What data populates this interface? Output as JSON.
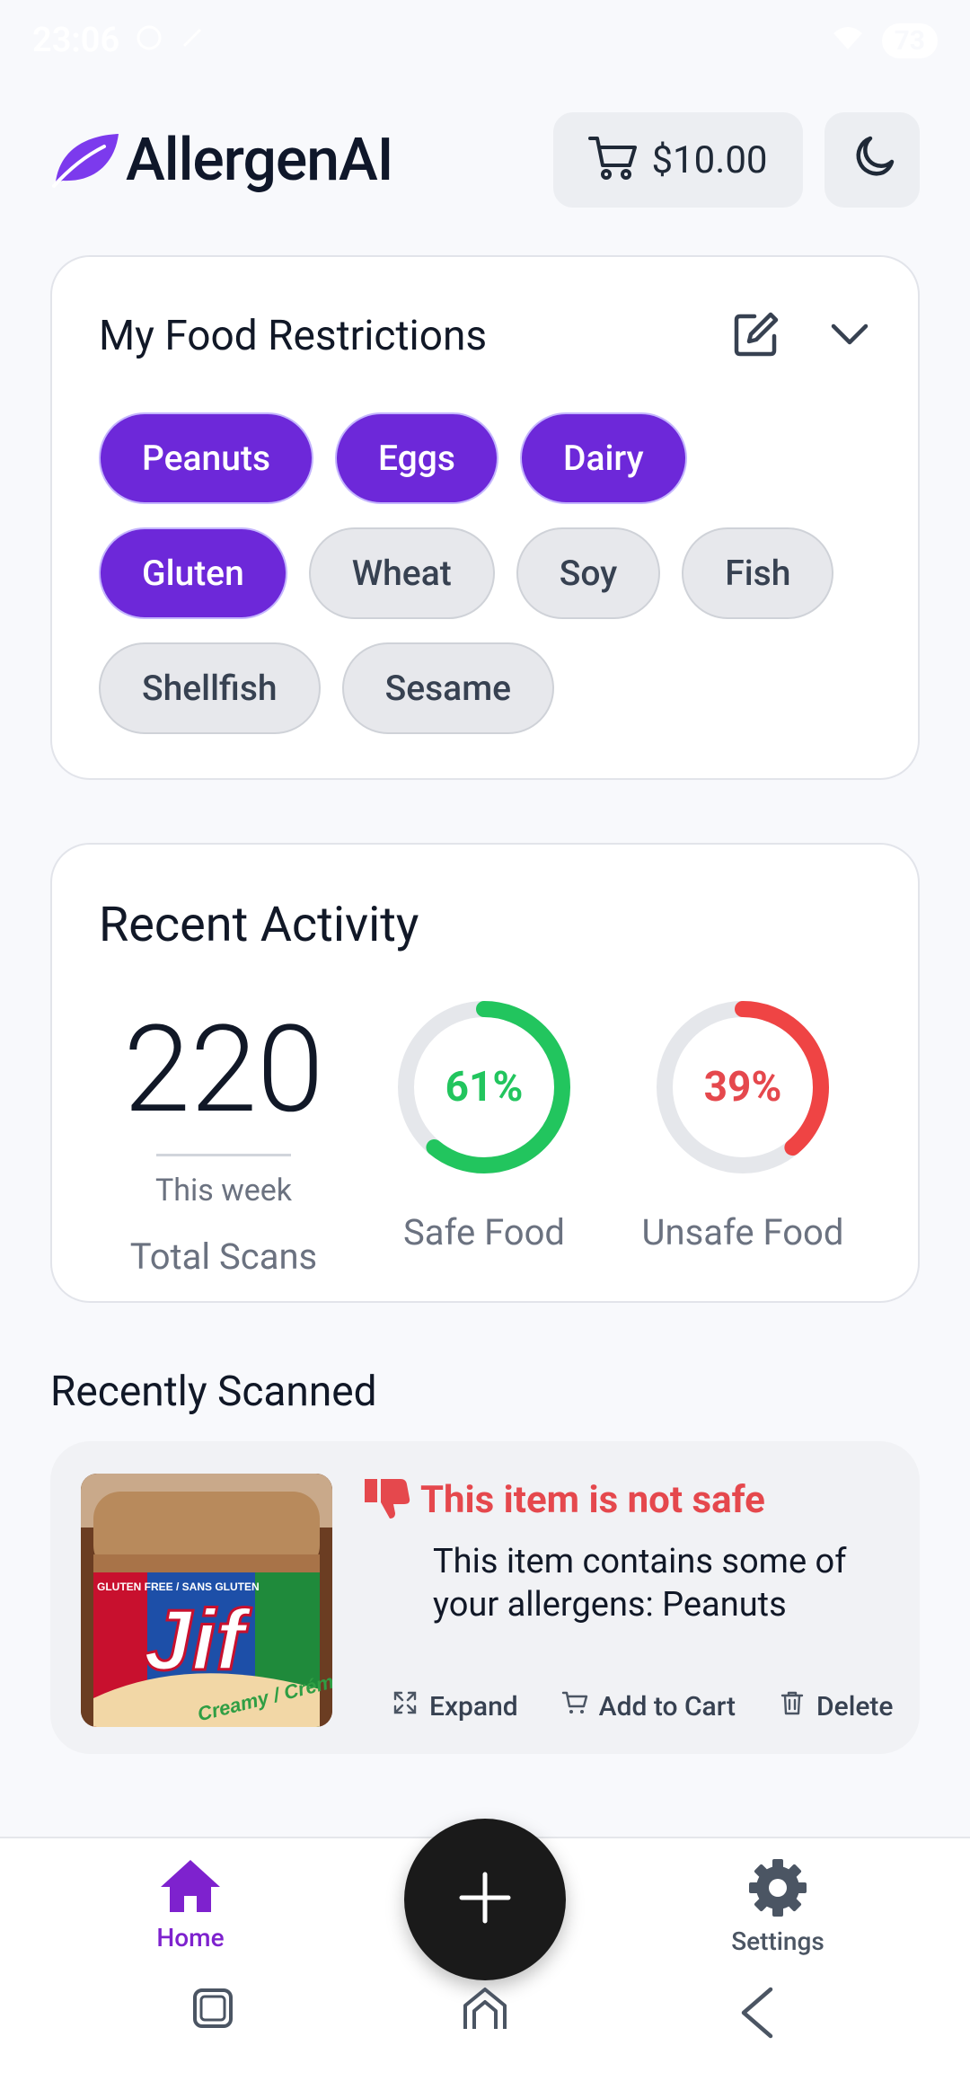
{
  "status_bar": {
    "time": "23:06",
    "battery": "73"
  },
  "header": {
    "brand": "AllergenAI",
    "cart_amount": "$10.00"
  },
  "restrictions": {
    "title": "My Food Restrictions",
    "chips": [
      {
        "label": "Peanuts",
        "selected": true
      },
      {
        "label": "Eggs",
        "selected": true
      },
      {
        "label": "Dairy",
        "selected": true
      },
      {
        "label": "Gluten",
        "selected": true
      },
      {
        "label": "Wheat",
        "selected": false
      },
      {
        "label": "Soy",
        "selected": false
      },
      {
        "label": "Fish",
        "selected": false
      },
      {
        "label": "Shellfish",
        "selected": false
      },
      {
        "label": "Sesame",
        "selected": false
      }
    ]
  },
  "activity": {
    "title": "Recent Activity",
    "total_scans": "220",
    "period": "This week",
    "total_label": "Total Scans",
    "safe_percent_text": "61%",
    "safe_fraction": 0.61,
    "safe_label": "Safe Food",
    "unsafe_percent_text": "39%",
    "unsafe_fraction": 0.39,
    "unsafe_label": "Unsafe Food"
  },
  "recently_scanned": {
    "title": "Recently Scanned",
    "items": [
      {
        "status": "This item is not safe",
        "description": "This item contains some of your allergens: Peanuts",
        "photo_brand": "Jif",
        "photo_label_small": "GLUTEN FREE / SANS GLUTEN",
        "photo_label_flavor": "Creamy / Crémeux",
        "actions": {
          "expand": "Expand",
          "add_to_cart": "Add to Cart",
          "delete": "Delete"
        }
      }
    ]
  },
  "nav": {
    "home": "Home",
    "settings": "Settings"
  },
  "colors": {
    "accent": "#6d28d9",
    "safe": "#22c55e",
    "unsafe": "#e5484d",
    "home_active": "#7e22ce"
  }
}
